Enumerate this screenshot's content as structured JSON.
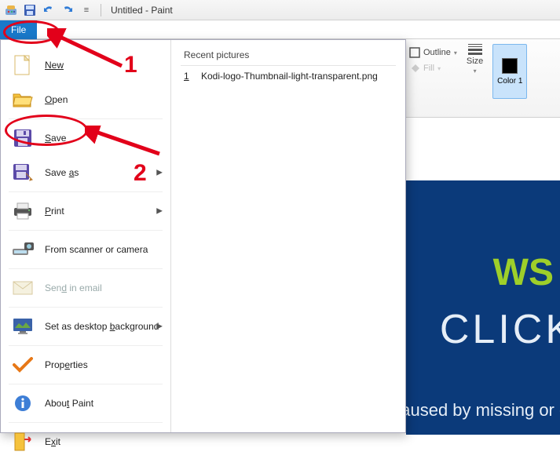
{
  "window": {
    "title": "Untitled - Paint"
  },
  "file_tab": {
    "label": "File"
  },
  "menu": {
    "new": "New",
    "open": "Open",
    "save": "Save",
    "save_as": "Save as",
    "print": "Print",
    "scanner": "From scanner or camera",
    "send": "Send in email",
    "desktop": "Set as desktop background",
    "properties": "Properties",
    "about": "About Paint",
    "exit": "Exit"
  },
  "recent": {
    "header": "Recent pictures",
    "items": [
      {
        "index": "1",
        "name": "Kodi-logo-Thumbnail-light-transparent.png"
      }
    ]
  },
  "ribbon": {
    "outline": "Outline",
    "fill": "Fill",
    "size": "Size",
    "color1": "Color 1"
  },
  "banner": {
    "ws": "WS",
    "click": "CLICK",
    "missing": "aused by missing or c"
  },
  "annotations": {
    "n1": "1",
    "n2": "2"
  }
}
